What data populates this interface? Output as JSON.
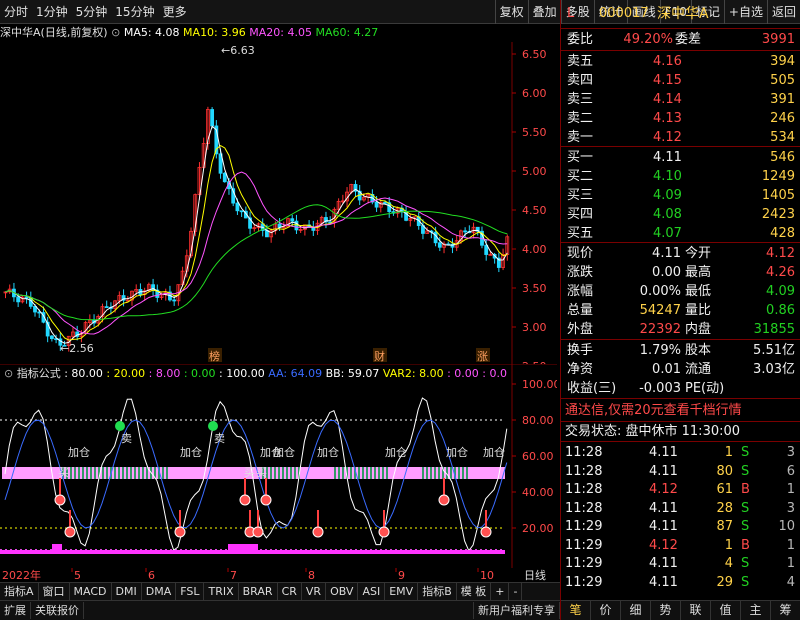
{
  "toolbar": {
    "left_items": [
      "分时",
      "1分钟",
      "5分钟",
      "15分钟",
      "更多"
    ],
    "right_items": [
      "复权",
      "叠加",
      "多股",
      "统计",
      "画线",
      "F10",
      "标记",
      "+自选",
      "返回"
    ]
  },
  "chart_header": {
    "stock_label": "深中华A(日线,前复权)",
    "ma5": "MA5: 4.08",
    "ma10": "MA10: 3.96",
    "ma20": "MA20: 4.05",
    "ma60": "MA60: 4.27",
    "high_mark": "6.63",
    "low_mark": "2.56",
    "tags": [
      "榜",
      "财",
      "涨"
    ],
    "colors": {
      "ma5": "#ffffff",
      "ma10": "#ffff00",
      "ma20": "#ff55ff",
      "ma60": "#22dd22",
      "up": "#ff3030",
      "down": "#22d8ff"
    }
  },
  "price_axis": [
    "6.50",
    "6.00",
    "5.50",
    "5.00",
    "4.50",
    "4.00",
    "3.50",
    "3.00",
    "2.50"
  ],
  "indicator_header": {
    "name": "指标公式",
    "params": [
      {
        "t": ": 80.00",
        "c": "#ffffff"
      },
      {
        "t": ": 20.00",
        "c": "#ffff00"
      },
      {
        "t": ": 8.00",
        "c": "#ff55ff"
      },
      {
        "t": ": 0.00",
        "c": "#22dd22"
      },
      {
        "t": ": 100.00",
        "c": "#ffffff"
      },
      {
        "t": "AA: 64.09",
        "c": "#3a6bff"
      },
      {
        "t": "BB: 59.07",
        "c": "#ffffff"
      },
      {
        "t": "VAR2: 8.00",
        "c": "#ffff00"
      },
      {
        "t": ": 0.00",
        "c": "#ff55ff"
      },
      {
        "t": ": 0.0",
        "c": "#ff55ff"
      }
    ]
  },
  "indicator_axis": [
    "100.00",
    "80.00",
    "60.00",
    "40.00",
    "20.00"
  ],
  "indicator_labels": {
    "add": "加仓",
    "sell": "卖",
    "buy": "买"
  },
  "x_axis": {
    "year": "2022年",
    "months": [
      "5",
      "6",
      "7",
      "8",
      "9",
      "10"
    ],
    "period": "日线"
  },
  "bottom_tabs_1": [
    "指标A",
    "窗口",
    "MACD",
    "DMI",
    "DMA",
    "FSL",
    "TRIX",
    "BRAR",
    "CR",
    "VR",
    "OBV",
    "ASI",
    "EMV",
    "指标B",
    "模 板",
    "+",
    "-"
  ],
  "bottom_tabs_2": [
    "扩展",
    "关联报价",
    "新用户福利专享"
  ],
  "quote": {
    "code": "000017",
    "name": "深中华A",
    "prefix": "L",
    "weibi": {
      "label": "委比",
      "value": "49.20%",
      "label2": "委差",
      "value2": "3991"
    },
    "sell": [
      {
        "label": "卖五",
        "price": "4.16",
        "vol": "394"
      },
      {
        "label": "卖四",
        "price": "4.15",
        "vol": "505"
      },
      {
        "label": "卖三",
        "price": "4.14",
        "vol": "391"
      },
      {
        "label": "卖二",
        "price": "4.13",
        "vol": "246"
      },
      {
        "label": "卖一",
        "price": "4.12",
        "vol": "534"
      }
    ],
    "buy": [
      {
        "label": "买一",
        "price": "4.11",
        "vol": "546",
        "pc": "white"
      },
      {
        "label": "买二",
        "price": "4.10",
        "vol": "1249",
        "pc": "green"
      },
      {
        "label": "买三",
        "price": "4.09",
        "vol": "1405",
        "pc": "green"
      },
      {
        "label": "买四",
        "price": "4.08",
        "vol": "2423",
        "pc": "green"
      },
      {
        "label": "买五",
        "price": "4.07",
        "vol": "428",
        "pc": "green"
      }
    ],
    "stats": [
      {
        "l1": "现价",
        "v1": "4.11",
        "c1": "white",
        "l2": "今开",
        "v2": "4.12",
        "c2": "red"
      },
      {
        "l1": "涨跌",
        "v1": "0.00",
        "c1": "white",
        "l2": "最高",
        "v2": "4.26",
        "c2": "red"
      },
      {
        "l1": "涨幅",
        "v1": "0.00%",
        "c1": "white",
        "l2": "最低",
        "v2": "4.09",
        "c2": "green"
      },
      {
        "l1": "总量",
        "v1": "54247",
        "c1": "yellow",
        "l2": "量比",
        "v2": "0.86",
        "c2": "green"
      },
      {
        "l1": "外盘",
        "v1": "22392",
        "c1": "red",
        "l2": "内盘",
        "v2": "31855",
        "c2": "green"
      }
    ],
    "stats2": [
      {
        "l1": "换手",
        "v1": "1.79%",
        "l2": "股本",
        "v2": "5.51亿"
      },
      {
        "l1": "净资",
        "v1": "0.01",
        "l2": "流通",
        "v2": "3.03亿"
      },
      {
        "l1": "收益(三)",
        "v1": "-0.003",
        "l2": "PE(动)",
        "v2": ""
      }
    ],
    "promo": "通达信,仅需20元查看千档行情",
    "trade_state": "交易状态: 盘中休市 11:30:00",
    "ticks": [
      {
        "t": "11:28",
        "p": "4.11",
        "pc": "white",
        "v": "1",
        "f": "S"
      },
      {
        "t": "11:28",
        "p": "4.11",
        "pc": "white",
        "v": "80",
        "f": "S"
      },
      {
        "t": "11:28",
        "p": "4.12",
        "pc": "red",
        "v": "61",
        "f": "B"
      },
      {
        "t": "11:28",
        "p": "4.11",
        "pc": "white",
        "v": "28",
        "f": "S"
      },
      {
        "t": "11:29",
        "p": "4.11",
        "pc": "white",
        "v": "87",
        "f": "S"
      },
      {
        "t": "11:29",
        "p": "4.12",
        "pc": "red",
        "v": "1",
        "f": "B"
      },
      {
        "t": "11:29",
        "p": "4.11",
        "pc": "white",
        "v": "4",
        "f": "S"
      },
      {
        "t": "11:29",
        "p": "4.11",
        "pc": "white",
        "v": "29",
        "f": "S"
      }
    ],
    "tick_counts": [
      "3",
      "6",
      "1",
      "3",
      "10",
      "1",
      "1",
      "4"
    ],
    "bottom_tabs": [
      "笔",
      "价",
      "细",
      "势",
      "联",
      "值",
      "主",
      "筹"
    ]
  }
}
